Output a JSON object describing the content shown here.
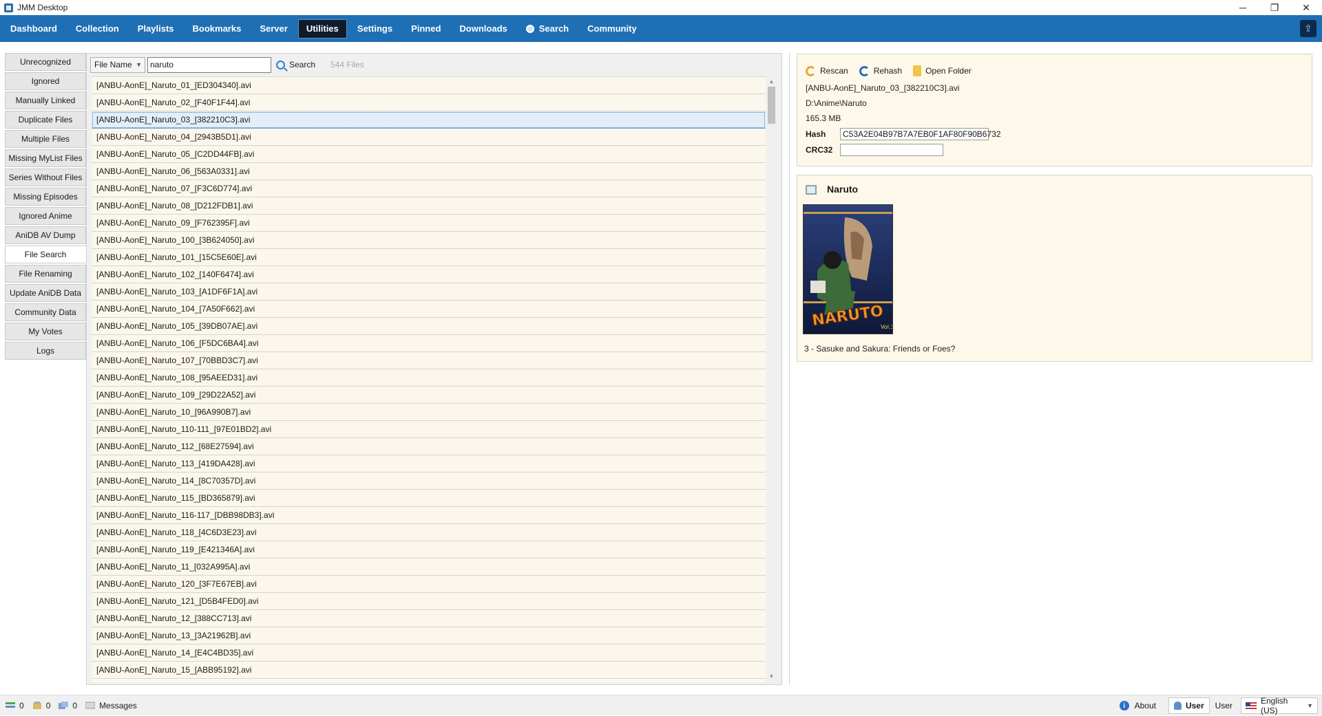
{
  "window": {
    "title": "JMM Desktop",
    "controls": {
      "minimize": "─",
      "restore": "❐",
      "close": "✕"
    }
  },
  "nav": {
    "items": [
      {
        "label": "Dashboard"
      },
      {
        "label": "Collection"
      },
      {
        "label": "Playlists"
      },
      {
        "label": "Bookmarks"
      },
      {
        "label": "Server"
      },
      {
        "label": "Utilities",
        "active": true
      },
      {
        "label": "Settings"
      },
      {
        "label": "Pinned"
      },
      {
        "label": "Downloads"
      },
      {
        "label": "Search"
      },
      {
        "label": "Community"
      }
    ],
    "right_icon": "upload-icon"
  },
  "left_tabs": [
    "Unrecognized",
    "Ignored",
    "Manually Linked",
    "Duplicate Files",
    "Multiple Files",
    "Missing MyList Files",
    "Series Without Files",
    "Missing Episodes",
    "Ignored Anime",
    "AniDB AV Dump",
    "File Search",
    "File Renaming",
    "Update AniDB Data",
    "Community Data",
    "My Votes",
    "Logs"
  ],
  "active_left_tab": "File Search",
  "search": {
    "field_select": "File Name",
    "query": "naruto",
    "button_label": "Search",
    "count_text": "544 Files"
  },
  "files": [
    "[ANBU-AonE]_Naruto_01_[ED304340].avi",
    "[ANBU-AonE]_Naruto_02_[F40F1F44].avi",
    "[ANBU-AonE]_Naruto_03_[382210C3].avi",
    "[ANBU-AonE]_Naruto_04_[2943B5D1].avi",
    "[ANBU-AonE]_Naruto_05_[C2DD44FB].avi",
    "[ANBU-AonE]_Naruto_06_[563A0331].avi",
    "[ANBU-AonE]_Naruto_07_[F3C6D774].avi",
    "[ANBU-AonE]_Naruto_08_[D212FDB1].avi",
    "[ANBU-AonE]_Naruto_09_[F762395F].avi",
    "[ANBU-AonE]_Naruto_100_[3B624050].avi",
    "[ANBU-AonE]_Naruto_101_[15C5E60E].avi",
    "[ANBU-AonE]_Naruto_102_[140F6474].avi",
    "[ANBU-AonE]_Naruto_103_[A1DF6F1A].avi",
    "[ANBU-AonE]_Naruto_104_[7A50F662].avi",
    "[ANBU-AonE]_Naruto_105_[39DB07AE].avi",
    "[ANBU-AonE]_Naruto_106_[F5DC6BA4].avi",
    "[ANBU-AonE]_Naruto_107_[70BBD3C7].avi",
    "[ANBU-AonE]_Naruto_108_[95AEED31].avi",
    "[ANBU-AonE]_Naruto_109_[29D22A52].avi",
    "[ANBU-AonE]_Naruto_10_[96A990B7].avi",
    "[ANBU-AonE]_Naruto_110-111_[97E01BD2].avi",
    "[ANBU-AonE]_Naruto_112_[68E27594].avi",
    "[ANBU-AonE]_Naruto_113_[419DA428].avi",
    "[ANBU-AonE]_Naruto_114_[8C70357D].avi",
    "[ANBU-AonE]_Naruto_115_[BD365879].avi",
    "[ANBU-AonE]_Naruto_116-117_[DBB98DB3].avi",
    "[ANBU-AonE]_Naruto_118_[4C6D3E23].avi",
    "[ANBU-AonE]_Naruto_119_[E421346A].avi",
    "[ANBU-AonE]_Naruto_11_[032A995A].avi",
    "[ANBU-AonE]_Naruto_120_[3F7E67EB].avi",
    "[ANBU-AonE]_Naruto_121_[D5B4FED0].avi",
    "[ANBU-AonE]_Naruto_12_[388CC713].avi",
    "[ANBU-AonE]_Naruto_13_[3A21962B].avi",
    "[ANBU-AonE]_Naruto_14_[E4C4BD35].avi",
    "[ANBU-AonE]_Naruto_15_[ABB95192].avi"
  ],
  "selected_file": "[ANBU-AonE]_Naruto_03_[382210C3].avi",
  "details": {
    "actions": {
      "rescan": "Rescan",
      "rehash": "Rehash",
      "open_folder": "Open Folder"
    },
    "file_name": "[ANBU-AonE]_Naruto_03_[382210C3].avi",
    "folder": "D:\\Anime\\Naruto",
    "size": "165.3 MB",
    "hash_label": "Hash",
    "hash_value": "C53A2E04B97B7A7EB0F1AF80F90B6732",
    "crc_label": "CRC32",
    "crc_value": ""
  },
  "series": {
    "title": "Naruto",
    "poster_text": "NARUTO",
    "poster_sub": "Vol.3",
    "episode": "3 - Sasuke and Sakura: Friends or Foes?"
  },
  "status": {
    "counts": [
      {
        "icon": "queue-icon",
        "value": "0"
      },
      {
        "icon": "hash-queue-icon",
        "value": "0"
      },
      {
        "icon": "images-queue-icon",
        "value": "0"
      }
    ],
    "messages_label": "Messages",
    "about_label": "About",
    "user_button": "User",
    "user_name": "User",
    "language": "English (US)"
  },
  "colors": {
    "nav_bg": "#1f6fb5",
    "nav_active_bg": "#0d1b2e",
    "list_bg": "#fcf7ec",
    "panel_bg": "#fdf8ea"
  }
}
